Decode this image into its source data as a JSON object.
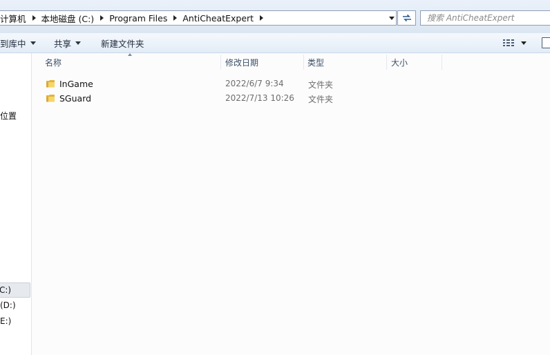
{
  "address_bar": {
    "crumbs": [
      "计算机",
      "本地磁盘 (C:)",
      "Program Files",
      "AntiCheatExpert"
    ]
  },
  "search": {
    "placeholder": "搜索 AntiCheatExpert"
  },
  "command_bar": {
    "include_in_library": "到库中",
    "share": "共享",
    "new_folder": "新建文件夹"
  },
  "nav": {
    "locations": "位置",
    "drives": [
      "C:)",
      " (D:)",
      "E:)"
    ]
  },
  "columns": {
    "name": "名称",
    "date_modified": "修改日期",
    "type": "类型",
    "size": "大小"
  },
  "files": [
    {
      "name": "InGame",
      "date": "2022/6/7 9:34",
      "type": "文件夹"
    },
    {
      "name": "SGuard",
      "date": "2022/7/13 10:26",
      "type": "文件夹"
    }
  ],
  "icons": {
    "folder": "folder-icon",
    "refresh": "refresh-icon",
    "view": "view-options-icon",
    "preview": "preview-pane-icon"
  },
  "colors": {
    "folder_yellow": "#f2c94c",
    "header_text": "#3b4f66",
    "selection_bg": "#e6e9ee"
  }
}
